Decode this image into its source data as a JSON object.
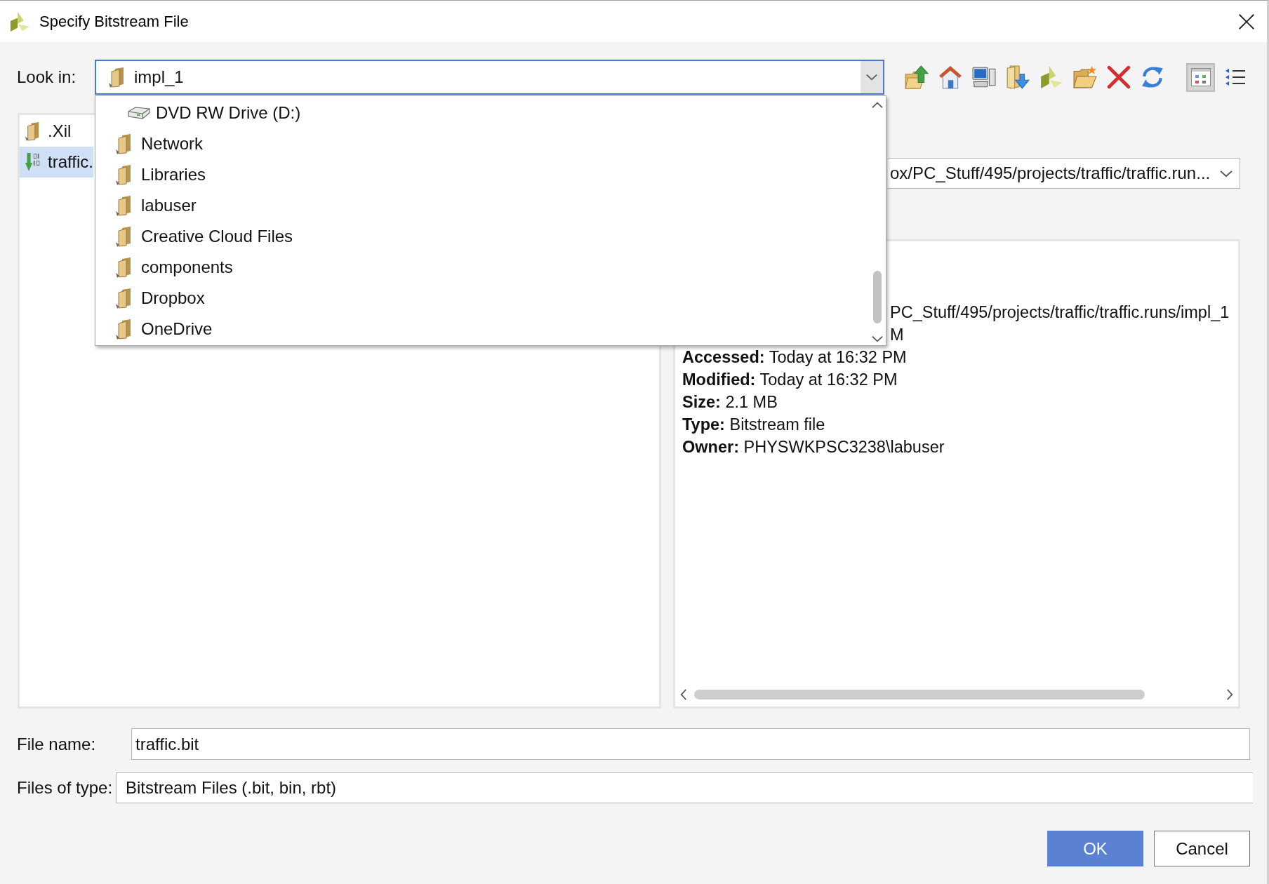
{
  "window": {
    "title": "Specify Bitstream File"
  },
  "look_in": {
    "label": "Look in:",
    "value": "impl_1",
    "expanded": true,
    "menu": [
      {
        "kind": "drive",
        "label": "DVD RW Drive (D:)"
      },
      {
        "kind": "folder",
        "label": "Network"
      },
      {
        "kind": "folder",
        "label": "Libraries"
      },
      {
        "kind": "folder",
        "label": "labuser"
      },
      {
        "kind": "folder",
        "label": "Creative Cloud Files"
      },
      {
        "kind": "folder",
        "label": "components"
      },
      {
        "kind": "folder",
        "label": "Dropbox"
      },
      {
        "kind": "folder",
        "label": "OneDrive"
      }
    ]
  },
  "toolbar": {
    "view_modes": [
      {
        "kind": "grid",
        "selected": true
      },
      {
        "kind": "list",
        "selected": false
      }
    ]
  },
  "file_list": {
    "items": [
      {
        "kind": "folder",
        "label": ".Xil",
        "selected": false
      },
      {
        "kind": "bitstream",
        "label": "traffic.",
        "selected": true
      }
    ]
  },
  "preview": {
    "location": "ox/PC_Stuff/495/projects/traffic/traffic.run...",
    "lines": [
      {
        "kind": "clipped",
        "text": "PC_Stuff/495/projects/traffic/traffic.runs/impl_1"
      },
      {
        "kind": "clipped",
        "text": "M"
      },
      {
        "kind": "field",
        "text": "**Accessed:** Today at 16:32 PM"
      },
      {
        "kind": "field",
        "text": "**Modified:** Today at 16:32 PM"
      },
      {
        "kind": "field",
        "text": "**Size:** 2.1 MB"
      },
      {
        "kind": "field",
        "text": "**Type:** Bitstream file"
      },
      {
        "kind": "field",
        "text": "**Owner:** PHYSWKPSC3238\\labuser"
      }
    ]
  },
  "file_name": {
    "label": "File name:",
    "value": "traffic.bit"
  },
  "file_type": {
    "label": "Files of type:",
    "value": "Bitstream Files (.bit, bin, rbt)"
  },
  "buttons": [
    {
      "kind": "primary",
      "label": "OK"
    },
    {
      "kind": "secondary",
      "label": "Cancel"
    }
  ]
}
